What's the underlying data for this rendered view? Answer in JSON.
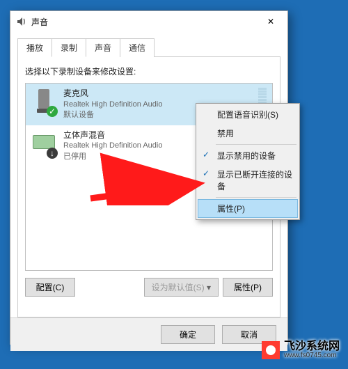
{
  "dialog": {
    "title": "声音",
    "close_glyph": "✕"
  },
  "tabs": {
    "playback": "播放",
    "recording": "录制",
    "sounds": "声音",
    "communications": "通信"
  },
  "prompt": "选择以下录制设备来修改设置:",
  "devices": {
    "microphone": {
      "name": "麦克风",
      "sub": "Realtek High Definition Audio",
      "status": "默认设备",
      "badge_glyph": "✓"
    },
    "stereo_mix": {
      "name": "立体声混音",
      "sub": "Realtek High Definition Audio",
      "status": "已停用",
      "badge_glyph": "↓"
    }
  },
  "buttons": {
    "configure": "配置(C)",
    "set_default": "设为默认值(S)",
    "properties": "属性(P)",
    "ok": "确定",
    "cancel": "取消"
  },
  "context_menu": {
    "configure_speech": "配置语音识别(S)",
    "disable": "禁用",
    "show_disabled": "显示禁用的设备",
    "show_disconnected": "显示已断开连接的设备",
    "properties": "属性(P)",
    "check_glyph": "✓"
  },
  "watermark": {
    "name": "飞沙系统网",
    "url": "www.fs0745.com"
  }
}
